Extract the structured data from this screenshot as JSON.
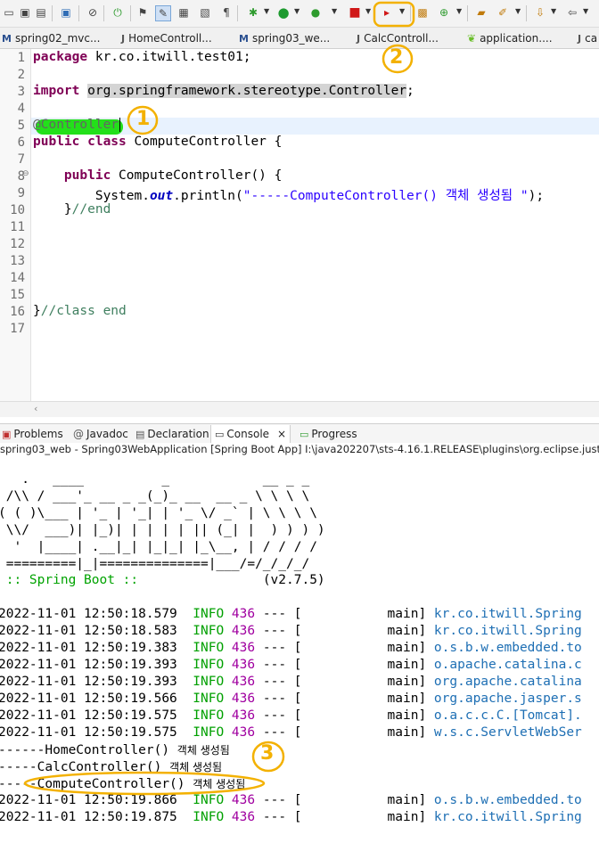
{
  "editor_tabs": [
    {
      "label": "spring02_mvc...",
      "icon": "M"
    },
    {
      "label": "HomeControll...",
      "icon": "J"
    },
    {
      "label": "spring03_we...",
      "icon": "M"
    },
    {
      "label": "CalcControll...",
      "icon": "J"
    },
    {
      "label": "application....",
      "icon": "leaf"
    },
    {
      "label": "ca",
      "icon": "J"
    }
  ],
  "line_numbers": [
    "1",
    "2",
    "3",
    "4",
    "5",
    "6",
    "7",
    "8",
    "9",
    "10",
    "11",
    "12",
    "13",
    "14",
    "15",
    "16",
    "17"
  ],
  "code": {
    "l1_kw": "package",
    "l1_rest": " kr.co.itwill.test01;",
    "l3_kw": "import",
    "l3_sp": " ",
    "l3_sel": "org.springframework.stereotype.Controller",
    "l3_end": ";",
    "l5": "@Controller",
    "l6_kw": "public class",
    "l6_rest": " ComputeController {",
    "l8_kw": "    public",
    "l8_rest": " ComputeController() {",
    "l9_a": "        System.",
    "l9_out": "out",
    "l9_b": ".println(",
    "l9_str": "\"-----ComputeController() 객체 생성됨 \"",
    "l9_c": ");",
    "l10_a": "    }",
    "l10_cmt": "//end",
    "l16_a": "}",
    "l16_cmt": "//class end",
    "fold_marker": "⊖"
  },
  "view_tabs": [
    {
      "label": "Problems"
    },
    {
      "label": "Javadoc"
    },
    {
      "label": "Declaration"
    },
    {
      "label": "Console",
      "close": "×"
    },
    {
      "label": "Progress"
    }
  ],
  "console_header": "spring03_web - Spring03WebApplication [Spring Boot App] I:\\java202207\\sts-4.16.1.RELEASE\\plugins\\org.eclipse.justj.openjdk",
  "banner": [
    "   .   ____          _            __ _ _",
    " /\\\\ / ___'_ __ _ _(_)_ __  __ _ \\ \\ \\ \\",
    "( ( )\\___ | '_ | '_| | '_ \\/ _` | \\ \\ \\ \\",
    " \\\\/  ___)| |_)| | | | | || (_| |  ) ) ) )",
    "  '  |____| .__|_| |_|_| |_\\__, | / / / /",
    " =========|_|==============|___/=/_/_/_/"
  ],
  "spring_boot_label": " :: Spring Boot :: ",
  "spring_boot_version": "               (v2.7.5)",
  "logs": [
    {
      "ts": "2022-11-01 12:50:18.579",
      "level": "INFO",
      "pid": "436",
      "mid": " --- [           main] ",
      "logger": "kr.co.itwill.Spring"
    },
    {
      "ts": "2022-11-01 12:50:18.583",
      "level": "INFO",
      "pid": "436",
      "mid": " --- [           main] ",
      "logger": "kr.co.itwill.Spring"
    },
    {
      "ts": "2022-11-01 12:50:19.383",
      "level": "INFO",
      "pid": "436",
      "mid": " --- [           main] ",
      "logger": "o.s.b.w.embedded.to"
    },
    {
      "ts": "2022-11-01 12:50:19.393",
      "level": "INFO",
      "pid": "436",
      "mid": " --- [           main] ",
      "logger": "o.apache.catalina.c"
    },
    {
      "ts": "2022-11-01 12:50:19.393",
      "level": "INFO",
      "pid": "436",
      "mid": " --- [           main] ",
      "logger": "org.apache.catalina"
    },
    {
      "ts": "2022-11-01 12:50:19.566",
      "level": "INFO",
      "pid": "436",
      "mid": " --- [           main] ",
      "logger": "org.apache.jasper.s"
    },
    {
      "ts": "2022-11-01 12:50:19.575",
      "level": "INFO",
      "pid": "436",
      "mid": " --- [           main] ",
      "logger": "o.a.c.c.C.[Tomcat]."
    },
    {
      "ts": "2022-11-01 12:50:19.575",
      "level": "INFO",
      "pid": "436",
      "mid": " --- [           main] ",
      "logger": "w.s.c.ServletWebSer"
    }
  ],
  "output_lines": [
    {
      "a": "------HomeController() ",
      "b": "객체 생성됨"
    },
    {
      "a": "-----CalcController() ",
      "b": "객체 생성됨"
    },
    {
      "a": "-----ComputeController() ",
      "b": "객체 생성됨"
    }
  ],
  "logs2": [
    {
      "ts": "2022-11-01 12:50:19.866",
      "level": "INFO",
      "pid": "436",
      "mid": " --- [           main] ",
      "logger": "o.s.b.w.embedded.to"
    },
    {
      "ts": "2022-11-01 12:50:19.875",
      "level": "INFO",
      "pid": "436",
      "mid": " --- [           main] ",
      "logger": "kr.co.itwill.Spring"
    }
  ],
  "markers": [
    "1",
    "2",
    "3"
  ],
  "colors": {
    "highlight": "#23e01a",
    "marker": "#f3b100",
    "keyword": "#7f0055",
    "string": "#2a00ff",
    "comment": "#3f7f5f"
  }
}
